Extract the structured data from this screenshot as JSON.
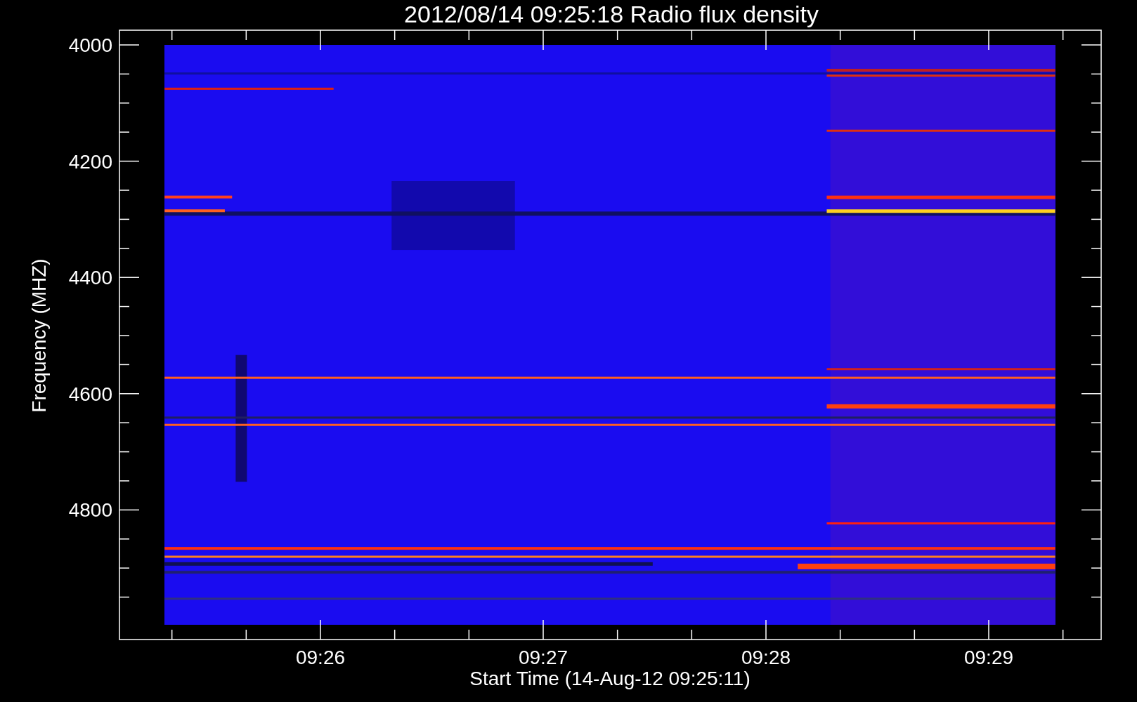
{
  "title": "2012/08/14 09:25:18 Radio flux density",
  "plot": {
    "ylabel": "Frequency (MHZ)",
    "yticks": [
      "4000",
      "4200",
      "4400",
      "4600",
      "4800"
    ],
    "xticks": [
      "09:26",
      "09:27",
      "09:28",
      "09:29"
    ],
    "xlabel": "Start Time (14-Aug-12 09:25:11)"
  }
}
